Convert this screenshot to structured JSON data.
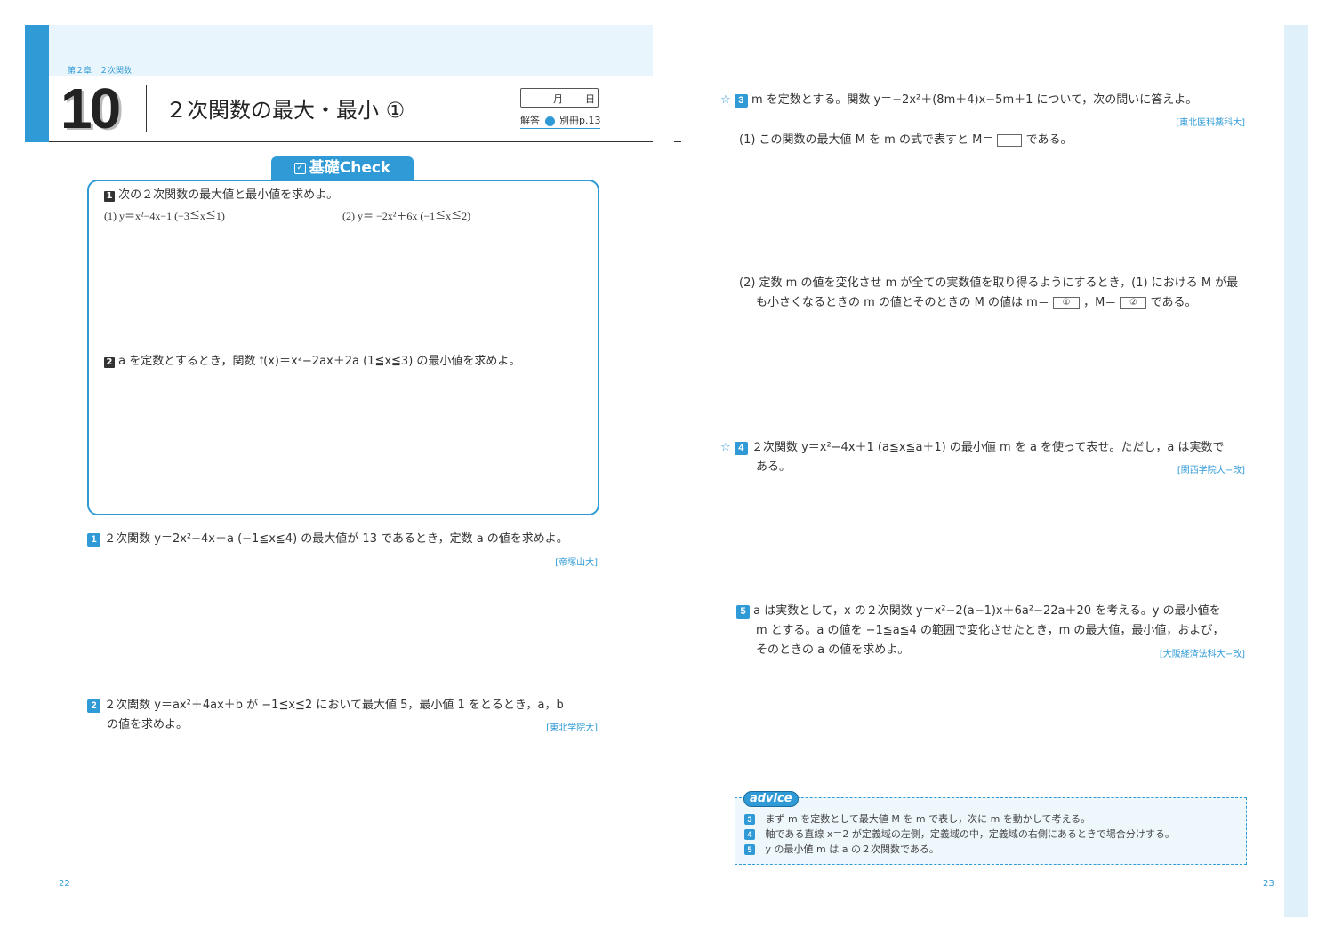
{
  "left_page": {
    "chapter_label": "第２章　２次関数",
    "lesson_number": "10",
    "lesson_title": "２次関数の最大・最小 ①",
    "date_month": "月",
    "date_day": "日",
    "answer_label": "解答",
    "answer_ref": "別冊p.13",
    "kiso_check_label": "基礎Check",
    "kiso": {
      "q1_num": "1",
      "q1_text": "次の２次関数の最大値と最小値を求めよ。",
      "q1_sub1": "(1)  y＝x²−4x−1 (−3≦x≦1)",
      "q1_sub2": "(2)  y＝ −2x²＋6x (−1≦x≦2)",
      "q2_num": "2",
      "q2_text": "a を定数とするとき，関数  f(x)＝x²−2ax＋2a (1≦x≦3)  の最小値を求めよ。"
    },
    "p1_num": "1",
    "p1_text": "２次関数  y＝2x²−4x＋a (−1≦x≦4)  の最大値が 13 であるとき，定数 a の値を求めよ。",
    "p1_source": "[帝塚山大]",
    "p2_num": "2",
    "p2_line1": "２次関数  y＝ax²＋4ax＋b  が  −1≦x≦2  において最大値 5，最小値 1 をとるとき，a，b",
    "p2_line2": "の値を求めよ。",
    "p2_source": "[東北学院大]",
    "page_number": "22"
  },
  "right_page": {
    "p3_star": "☆",
    "p3_num": "3",
    "p3_text": "m を定数とする。関数  y＝−2x²＋(8m＋4)x−5m＋1  について，次の問いに答えよ。",
    "p3_source": "[東北医科薬科大]",
    "p3_sub1_pre": "(1) この関数の最大値 M を m の式で表すと  M＝",
    "p3_sub1_post": "である。",
    "p3_sub2_line1": "(2) 定数 m の値を変化させ m が全ての実数値を取り得るようにするとき，(1) における M が最",
    "p3_sub2_line2_pre": "も小さくなるときの m の値とそのときの M の値は  m＝",
    "p3_box1": "①",
    "p3_mid": "，M＝",
    "p3_box2": "②",
    "p3_sub2_post": "である。",
    "p4_star": "☆",
    "p4_num": "4",
    "p4_line1": "２次関数  y＝x²−4x＋1 (a≦x≦a＋1)  の最小値 m を a を使って表せ。ただし，a は実数で",
    "p4_line2": "ある。",
    "p4_source": "[関西学院大−改]",
    "p5_num": "5",
    "p5_line1": "a は実数として，x の２次関数  y＝x²−2(a−1)x＋6a²−22a＋20  を考える。y の最小値を",
    "p5_line2": "m とする。a の値を  −1≦a≦4  の範囲で変化させたとき，m の最大値，最小値，および，",
    "p5_line3": "そのときの a の値を求めよ。",
    "p5_source": "[大阪経済法科大−改]",
    "advice_label": "advice",
    "advice_items": [
      {
        "num": "3",
        "text": "まず m を定数として最大値 M を m で表し，次に m を動かして考える。"
      },
      {
        "num": "4",
        "text": "軸である直線  x＝2  が定義域の左側，定義域の中，定義域の右側にあるときで場合分けする。"
      },
      {
        "num": "5",
        "text": "y の最小値 m は a の２次関数である。"
      }
    ],
    "page_number": "23"
  },
  "colors": {
    "accent": "#2f9ad6",
    "header_bg": "#e9f5fc",
    "advice_bg": "#eef7fc"
  }
}
